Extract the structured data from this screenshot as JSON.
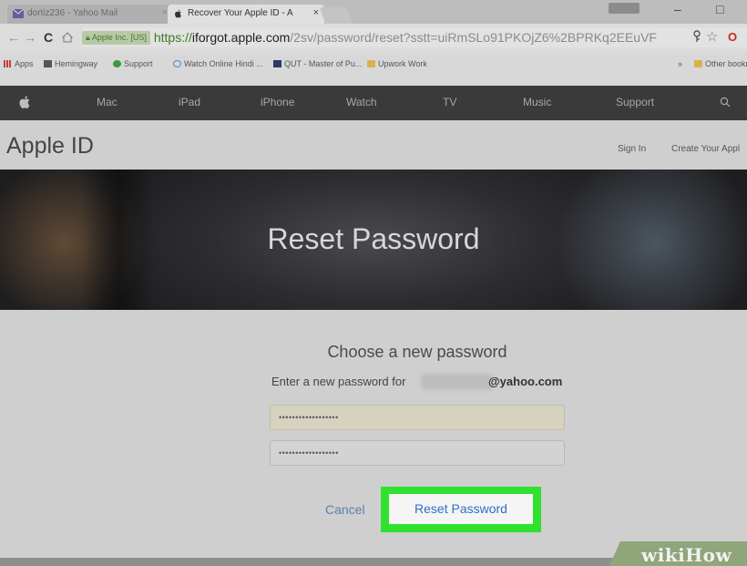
{
  "browser": {
    "tabs": [
      {
        "label": "dortiz236 - Yahoo Mail",
        "active": false
      },
      {
        "label": "Recover Your Apple ID - A",
        "active": true
      }
    ],
    "close_glyph": "×",
    "window_controls": {
      "minimize": "–",
      "maximize": "□"
    },
    "nav": {
      "back": "←",
      "forward": "→",
      "reload": "C"
    },
    "security_badge": "Apple Inc. [US]",
    "url": {
      "scheme": "https://",
      "host": "iforgot.apple.com",
      "path": "/2sv/password/reset?sstt=uiRmSLo91PKOjZ6%2BPRKq2EEuVF"
    },
    "toolbar_icons": {
      "key": "key-icon",
      "star": "☆",
      "opera": "O"
    },
    "bookmarks": [
      {
        "label": "Apps",
        "icon": "apps-grid-icon"
      },
      {
        "label": "Hemingway",
        "icon": "hemingway-icon"
      },
      {
        "label": "Support",
        "icon": "support-icon"
      },
      {
        "label": "Watch Online Hindi ...",
        "icon": "globe-icon"
      },
      {
        "label": "QUT - Master of Pu...",
        "icon": "qut-icon"
      },
      {
        "label": "Upwork Work",
        "icon": "folder-icon"
      },
      {
        "label": "»",
        "icon": ""
      },
      {
        "label": "Other bookmarks",
        "icon": "folder-icon"
      }
    ]
  },
  "apple_nav": {
    "logo": "",
    "items": [
      "Mac",
      "iPad",
      "iPhone",
      "Watch",
      "TV",
      "Music",
      "Support"
    ],
    "search_glyph": "⚲"
  },
  "apple_id": {
    "title": "Apple ID",
    "sign_in": "Sign In",
    "create": "Create Your Appl"
  },
  "hero": {
    "title": "Reset Password"
  },
  "form": {
    "heading": "Choose a new password",
    "enter_for": "Enter a new password for",
    "email_domain": "@yahoo.com",
    "new_password_value": "••••••••••••••••••",
    "confirm_password_value": "••••••••••••••••••",
    "cancel_label": "Cancel",
    "reset_label": "Reset Password",
    "highlight_color": "#2fe22f",
    "link_color": "#2c6fc9"
  },
  "watermark": {
    "text": "wikiHow"
  }
}
